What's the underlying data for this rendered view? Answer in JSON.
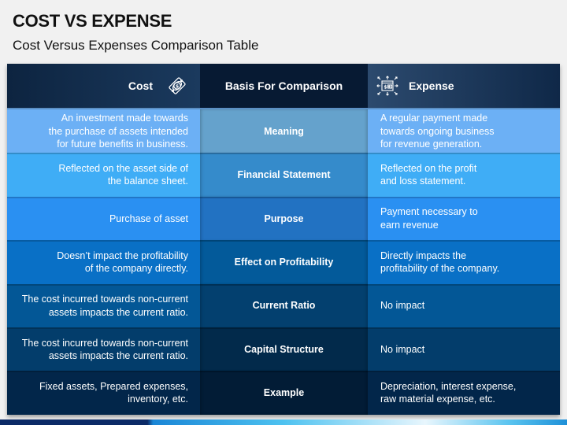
{
  "header": {
    "title": "COST VS EXPENSE",
    "subtitle": "Cost Versus Expenses Comparison Table"
  },
  "table": {
    "columns": [
      {
        "label": "Cost",
        "icon": "money-bill-icon"
      },
      {
        "label": "Basis For Comparison"
      },
      {
        "label": "Expense",
        "icon": "wallet-spending-icon"
      }
    ],
    "rows": [
      {
        "basis": "Meaning",
        "cost": "An investment made towards\nthe purchase of assets intended\nfor future benefits in business.",
        "expense": "A regular payment made\ntowards ongoing business\nfor revenue generation.",
        "side_color": "#6cb0f5",
        "mid_color": "#65a2cc"
      },
      {
        "basis": "Financial Statement",
        "cost": "Reflected on the asset side of\nthe balance sheet.",
        "expense": "Reflected on the profit\nand loss statement.",
        "side_color": "#3fadf6",
        "mid_color": "#358bcb"
      },
      {
        "basis": "Purpose",
        "cost": "Purchase of asset",
        "expense": "Payment necessary to\nearn revenue",
        "side_color": "#2a90f2",
        "mid_color": "#2272c2"
      },
      {
        "basis": "Effect on Profitability",
        "cost": "Doesn’t impact the profitability\nof the company directly.",
        "expense": "Directly impacts the\nprofitability of the company.",
        "side_color": "#0970c6",
        "mid_color": "#035a9a"
      },
      {
        "basis": "Current Ratio",
        "cost": "The cost incurred towards non-current\nassets impacts the current ratio.",
        "expense": "No impact",
        "side_color": "#035796",
        "mid_color": "#03406f"
      },
      {
        "basis": "Capital Structure",
        "cost": "The cost incurred towards non-current\nassets impacts the current ratio.",
        "expense": "No impact",
        "side_color": "#033d6b",
        "mid_color": "#022a4b"
      },
      {
        "basis": "Example",
        "cost": "Fixed assets, Prepared expenses,\ninventory, etc.",
        "expense": "Depreciation, interest expense,\nraw material expense, etc.",
        "side_color": "#02264a",
        "mid_color": "#021c36"
      }
    ]
  }
}
